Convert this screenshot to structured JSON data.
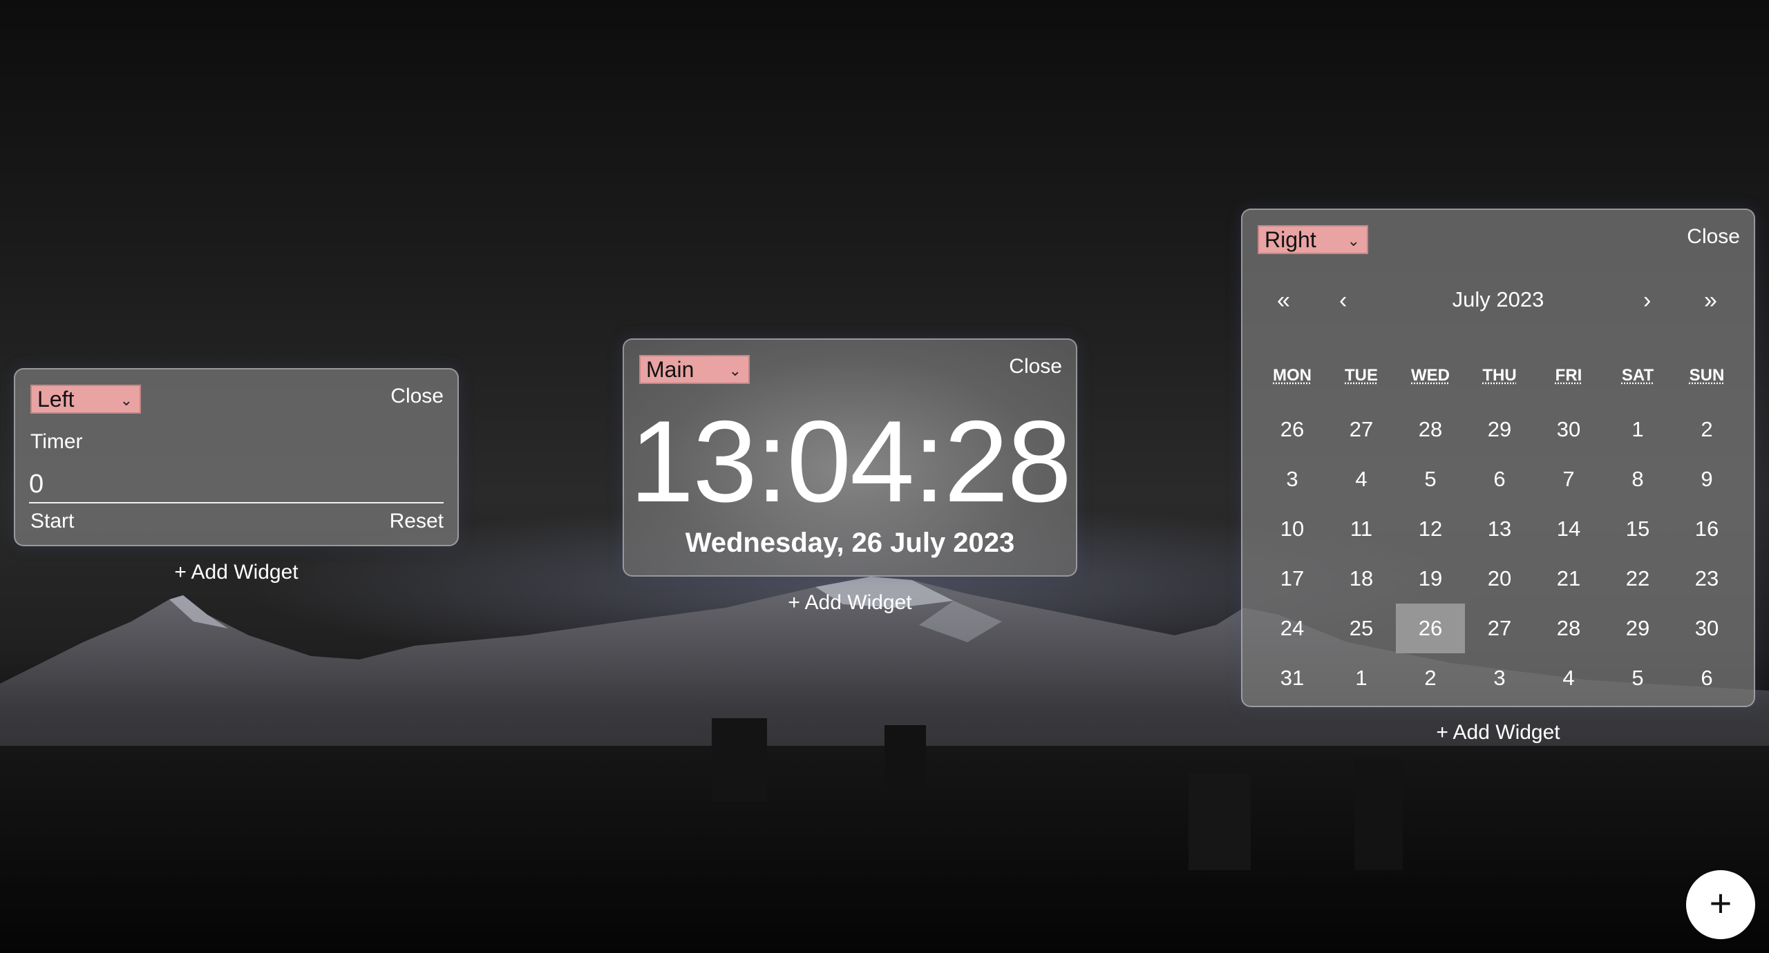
{
  "left_widget": {
    "position_select": "Left",
    "close_label": "Close",
    "title": "Timer",
    "value": "0",
    "start_label": "Start",
    "reset_label": "Reset",
    "add_widget_label": "+ Add Widget"
  },
  "main_widget": {
    "position_select": "Main",
    "close_label": "Close",
    "time": "13:04:28",
    "date": "Wednesday, 26 July 2023",
    "add_widget_label": "+ Add Widget"
  },
  "right_widget": {
    "position_select": "Right",
    "close_label": "Close",
    "month_title": "July 2023",
    "nav": {
      "prev_year": "«",
      "prev_month": "‹",
      "next_month": "›",
      "next_year": "»"
    },
    "weekdays": [
      "MON",
      "TUE",
      "WED",
      "THU",
      "FRI",
      "SAT",
      "SUN"
    ],
    "weeks": [
      [
        "26",
        "27",
        "28",
        "29",
        "30",
        "1",
        "2"
      ],
      [
        "3",
        "4",
        "5",
        "6",
        "7",
        "8",
        "9"
      ],
      [
        "10",
        "11",
        "12",
        "13",
        "14",
        "15",
        "16"
      ],
      [
        "17",
        "18",
        "19",
        "20",
        "21",
        "22",
        "23"
      ],
      [
        "24",
        "25",
        "26",
        "27",
        "28",
        "29",
        "30"
      ],
      [
        "31",
        "1",
        "2",
        "3",
        "4",
        "5",
        "6"
      ]
    ],
    "selected_day": "26",
    "add_widget_label": "+ Add Widget"
  },
  "fab": {
    "icon": "plus-icon",
    "label": "+"
  },
  "colors": {
    "select_bg": "#e9a3a3",
    "panel_bg": "#7a7a7a",
    "selected_day_bg": "#a0a0a0"
  }
}
